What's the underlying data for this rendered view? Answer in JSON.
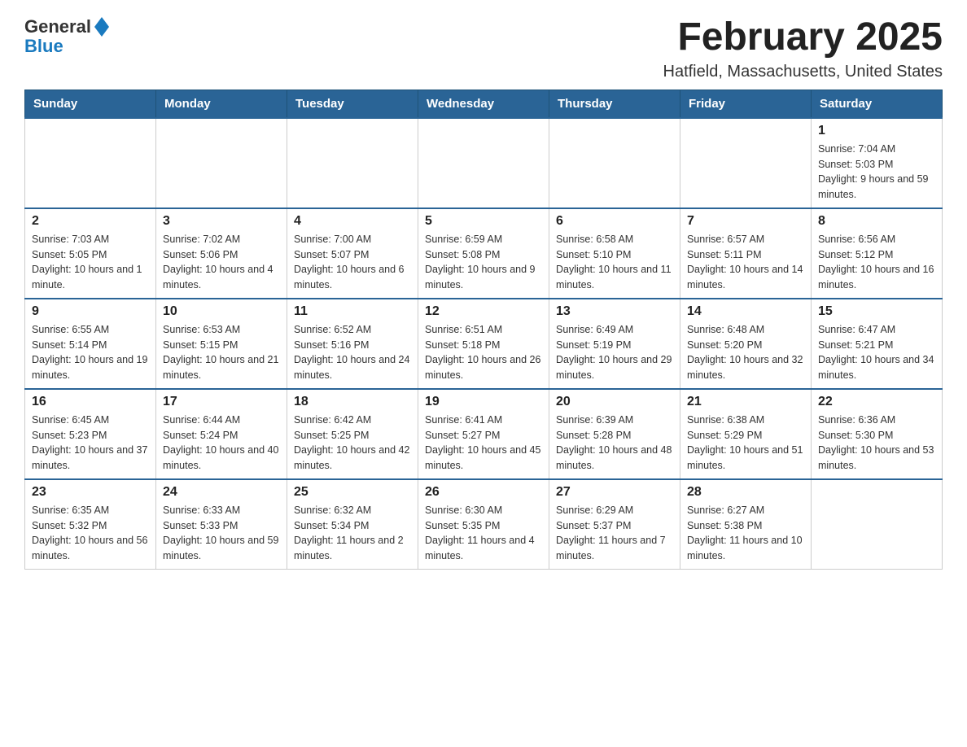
{
  "header": {
    "logo": {
      "general": "General",
      "blue": "Blue"
    },
    "title": "February 2025",
    "location": "Hatfield, Massachusetts, United States"
  },
  "calendar": {
    "days_of_week": [
      "Sunday",
      "Monday",
      "Tuesday",
      "Wednesday",
      "Thursday",
      "Friday",
      "Saturday"
    ],
    "weeks": [
      [
        {
          "day": "",
          "info": ""
        },
        {
          "day": "",
          "info": ""
        },
        {
          "day": "",
          "info": ""
        },
        {
          "day": "",
          "info": ""
        },
        {
          "day": "",
          "info": ""
        },
        {
          "day": "",
          "info": ""
        },
        {
          "day": "1",
          "info": "Sunrise: 7:04 AM\nSunset: 5:03 PM\nDaylight: 9 hours and 59 minutes."
        }
      ],
      [
        {
          "day": "2",
          "info": "Sunrise: 7:03 AM\nSunset: 5:05 PM\nDaylight: 10 hours and 1 minute."
        },
        {
          "day": "3",
          "info": "Sunrise: 7:02 AM\nSunset: 5:06 PM\nDaylight: 10 hours and 4 minutes."
        },
        {
          "day": "4",
          "info": "Sunrise: 7:00 AM\nSunset: 5:07 PM\nDaylight: 10 hours and 6 minutes."
        },
        {
          "day": "5",
          "info": "Sunrise: 6:59 AM\nSunset: 5:08 PM\nDaylight: 10 hours and 9 minutes."
        },
        {
          "day": "6",
          "info": "Sunrise: 6:58 AM\nSunset: 5:10 PM\nDaylight: 10 hours and 11 minutes."
        },
        {
          "day": "7",
          "info": "Sunrise: 6:57 AM\nSunset: 5:11 PM\nDaylight: 10 hours and 14 minutes."
        },
        {
          "day": "8",
          "info": "Sunrise: 6:56 AM\nSunset: 5:12 PM\nDaylight: 10 hours and 16 minutes."
        }
      ],
      [
        {
          "day": "9",
          "info": "Sunrise: 6:55 AM\nSunset: 5:14 PM\nDaylight: 10 hours and 19 minutes."
        },
        {
          "day": "10",
          "info": "Sunrise: 6:53 AM\nSunset: 5:15 PM\nDaylight: 10 hours and 21 minutes."
        },
        {
          "day": "11",
          "info": "Sunrise: 6:52 AM\nSunset: 5:16 PM\nDaylight: 10 hours and 24 minutes."
        },
        {
          "day": "12",
          "info": "Sunrise: 6:51 AM\nSunset: 5:18 PM\nDaylight: 10 hours and 26 minutes."
        },
        {
          "day": "13",
          "info": "Sunrise: 6:49 AM\nSunset: 5:19 PM\nDaylight: 10 hours and 29 minutes."
        },
        {
          "day": "14",
          "info": "Sunrise: 6:48 AM\nSunset: 5:20 PM\nDaylight: 10 hours and 32 minutes."
        },
        {
          "day": "15",
          "info": "Sunrise: 6:47 AM\nSunset: 5:21 PM\nDaylight: 10 hours and 34 minutes."
        }
      ],
      [
        {
          "day": "16",
          "info": "Sunrise: 6:45 AM\nSunset: 5:23 PM\nDaylight: 10 hours and 37 minutes."
        },
        {
          "day": "17",
          "info": "Sunrise: 6:44 AM\nSunset: 5:24 PM\nDaylight: 10 hours and 40 minutes."
        },
        {
          "day": "18",
          "info": "Sunrise: 6:42 AM\nSunset: 5:25 PM\nDaylight: 10 hours and 42 minutes."
        },
        {
          "day": "19",
          "info": "Sunrise: 6:41 AM\nSunset: 5:27 PM\nDaylight: 10 hours and 45 minutes."
        },
        {
          "day": "20",
          "info": "Sunrise: 6:39 AM\nSunset: 5:28 PM\nDaylight: 10 hours and 48 minutes."
        },
        {
          "day": "21",
          "info": "Sunrise: 6:38 AM\nSunset: 5:29 PM\nDaylight: 10 hours and 51 minutes."
        },
        {
          "day": "22",
          "info": "Sunrise: 6:36 AM\nSunset: 5:30 PM\nDaylight: 10 hours and 53 minutes."
        }
      ],
      [
        {
          "day": "23",
          "info": "Sunrise: 6:35 AM\nSunset: 5:32 PM\nDaylight: 10 hours and 56 minutes."
        },
        {
          "day": "24",
          "info": "Sunrise: 6:33 AM\nSunset: 5:33 PM\nDaylight: 10 hours and 59 minutes."
        },
        {
          "day": "25",
          "info": "Sunrise: 6:32 AM\nSunset: 5:34 PM\nDaylight: 11 hours and 2 minutes."
        },
        {
          "day": "26",
          "info": "Sunrise: 6:30 AM\nSunset: 5:35 PM\nDaylight: 11 hours and 4 minutes."
        },
        {
          "day": "27",
          "info": "Sunrise: 6:29 AM\nSunset: 5:37 PM\nDaylight: 11 hours and 7 minutes."
        },
        {
          "day": "28",
          "info": "Sunrise: 6:27 AM\nSunset: 5:38 PM\nDaylight: 11 hours and 10 minutes."
        },
        {
          "day": "",
          "info": ""
        }
      ]
    ]
  }
}
